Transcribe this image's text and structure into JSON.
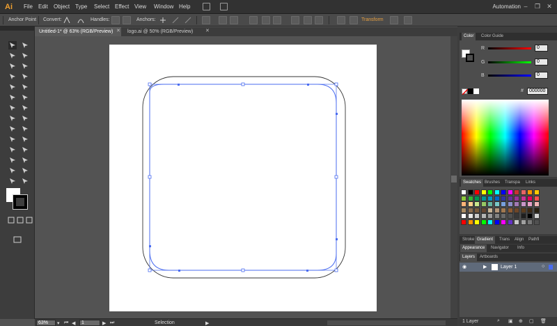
{
  "app": {
    "logo": "Ai",
    "workspace": "Automation"
  },
  "menu": [
    "File",
    "Edit",
    "Object",
    "Type",
    "Select",
    "Effect",
    "View",
    "Window",
    "Help"
  ],
  "control_bar": {
    "tool_name": "Anchor Point",
    "convert_label": "Convert:",
    "handles_label": "Handles:",
    "anchors_label": "Anchors:",
    "transform_label": "Transform"
  },
  "tabs": [
    {
      "label": "Untitled-1* @ 63% (RGB/Preview)",
      "active": true
    },
    {
      "label": "logo.ai @ 50% (RGB/Preview)",
      "active": false
    }
  ],
  "status_bar": {
    "zoom": "63%",
    "artboard": "1",
    "tool": "Selection"
  },
  "color_panel": {
    "tabs": [
      "Color",
      "Color Guide"
    ],
    "r_label": "R",
    "g_label": "G",
    "b_label": "B",
    "r_value": "0",
    "g_value": "0",
    "b_value": "0",
    "hex": "000000"
  },
  "swatches_panel": {
    "tabs": [
      "Swatches",
      "Brushes",
      "Transpa",
      "Links"
    ],
    "colors": [
      "#ffffff",
      "#000000",
      "#ff0000",
      "#ffff00",
      "#00ff00",
      "#00ffff",
      "#0000ff",
      "#ff00ff",
      "#c83232",
      "#e66464",
      "#ff9600",
      "#ffc800",
      "#8cc83c",
      "#32b432",
      "#009650",
      "#009696",
      "#0096c8",
      "#0064c8",
      "#3232a0",
      "#643296",
      "#963296",
      "#c83296",
      "#e6005a",
      "#ff5050",
      "#ffb478",
      "#ffd28c",
      "#c8e68c",
      "#96c864",
      "#64b4a0",
      "#78c8c8",
      "#78a0dc",
      "#8c8cc8",
      "#a078b4",
      "#c896c8",
      "#e6a0c8",
      "#f0b4b4",
      "#aa8c64",
      "#8c6e50",
      "#785a3c",
      "#644632",
      "#c8b496",
      "#b49678",
      "#a07850",
      "#8c5a32",
      "#6e4628",
      "#5a3c1e",
      "#3c2814",
      "#282010",
      "#ffffff",
      "#e6e6e6",
      "#cdcdcd",
      "#b4b4b4",
      "#9b9b9b",
      "#828282",
      "#696969",
      "#505050",
      "#373737",
      "#1e1e1e",
      "#000000",
      "#d2d2d2",
      "#ff0000",
      "#ff9600",
      "#ffff00",
      "#00ff00",
      "#00ffff",
      "#0000ff",
      "#ff00ff",
      "#6432c8",
      "#c8c8c8",
      "#a0a0a0",
      "#787878",
      "#505050"
    ]
  },
  "appearance_panel": {
    "tabs": [
      "Stroke",
      "Gradient",
      "Trans",
      "Align",
      "Pathfi"
    ]
  },
  "appearance2_panel": {
    "tabs": [
      "Appearance",
      "Navigator",
      "Info"
    ]
  },
  "layers_panel": {
    "tabs": [
      "Layers",
      "Artboards"
    ],
    "layers": [
      {
        "name": "Layer 1"
      }
    ],
    "footer": "1 Layer"
  },
  "theme": {
    "accent": "#e8a040",
    "selection_blue": "#4a6cf0"
  }
}
